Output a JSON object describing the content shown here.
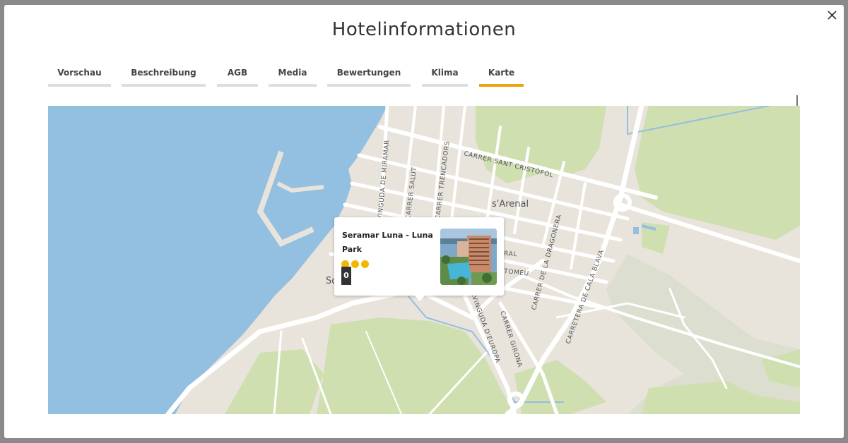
{
  "modal": {
    "title": "Hotelinformationen",
    "close_icon": "close-icon"
  },
  "tabs": [
    {
      "label": "Vorschau"
    },
    {
      "label": "Beschreibung"
    },
    {
      "label": "AGB"
    },
    {
      "label": "Media"
    },
    {
      "label": "Bewertungen"
    },
    {
      "label": "Klima"
    },
    {
      "label": "Karte"
    }
  ],
  "active_tab": "Karte",
  "colors": {
    "accent": "#f0a30a",
    "water": "#93bfe0",
    "land": "#e8e4dc",
    "park": "#cfdfb0",
    "road": "#ffffff",
    "star": "#f2b705"
  },
  "map": {
    "place_labels": {
      "s_arenal": "s'Arenal",
      "so_partial": "So"
    },
    "street_labels": {
      "carrer_sant_cristofol": "CARRER SANT CRISTÒFOL",
      "avinguda_de_miramar": "AVINGUDA DE MIRAMAR",
      "carrer_salut": "CARRER SALUT",
      "carrer_trencadors": "CARRER TRENCADORS",
      "carrer_de_la_dragonera": "CARRER DE LA DRAGONERA",
      "carretera_de_cala_blava": "CARRETERA DE CALA BLAVA",
      "avinguda_d_europa": "AVINGUDA D'EUROPA",
      "carrer_girona": "CARRER GIRONA",
      "tomeu_partial": "TOMEU",
      "ral_partial": "RAL"
    }
  },
  "popup": {
    "hotel_name": "Seramar Luna - Luna Park",
    "stars": 3,
    "score": "0",
    "photo_icon": "hotel-photo"
  }
}
